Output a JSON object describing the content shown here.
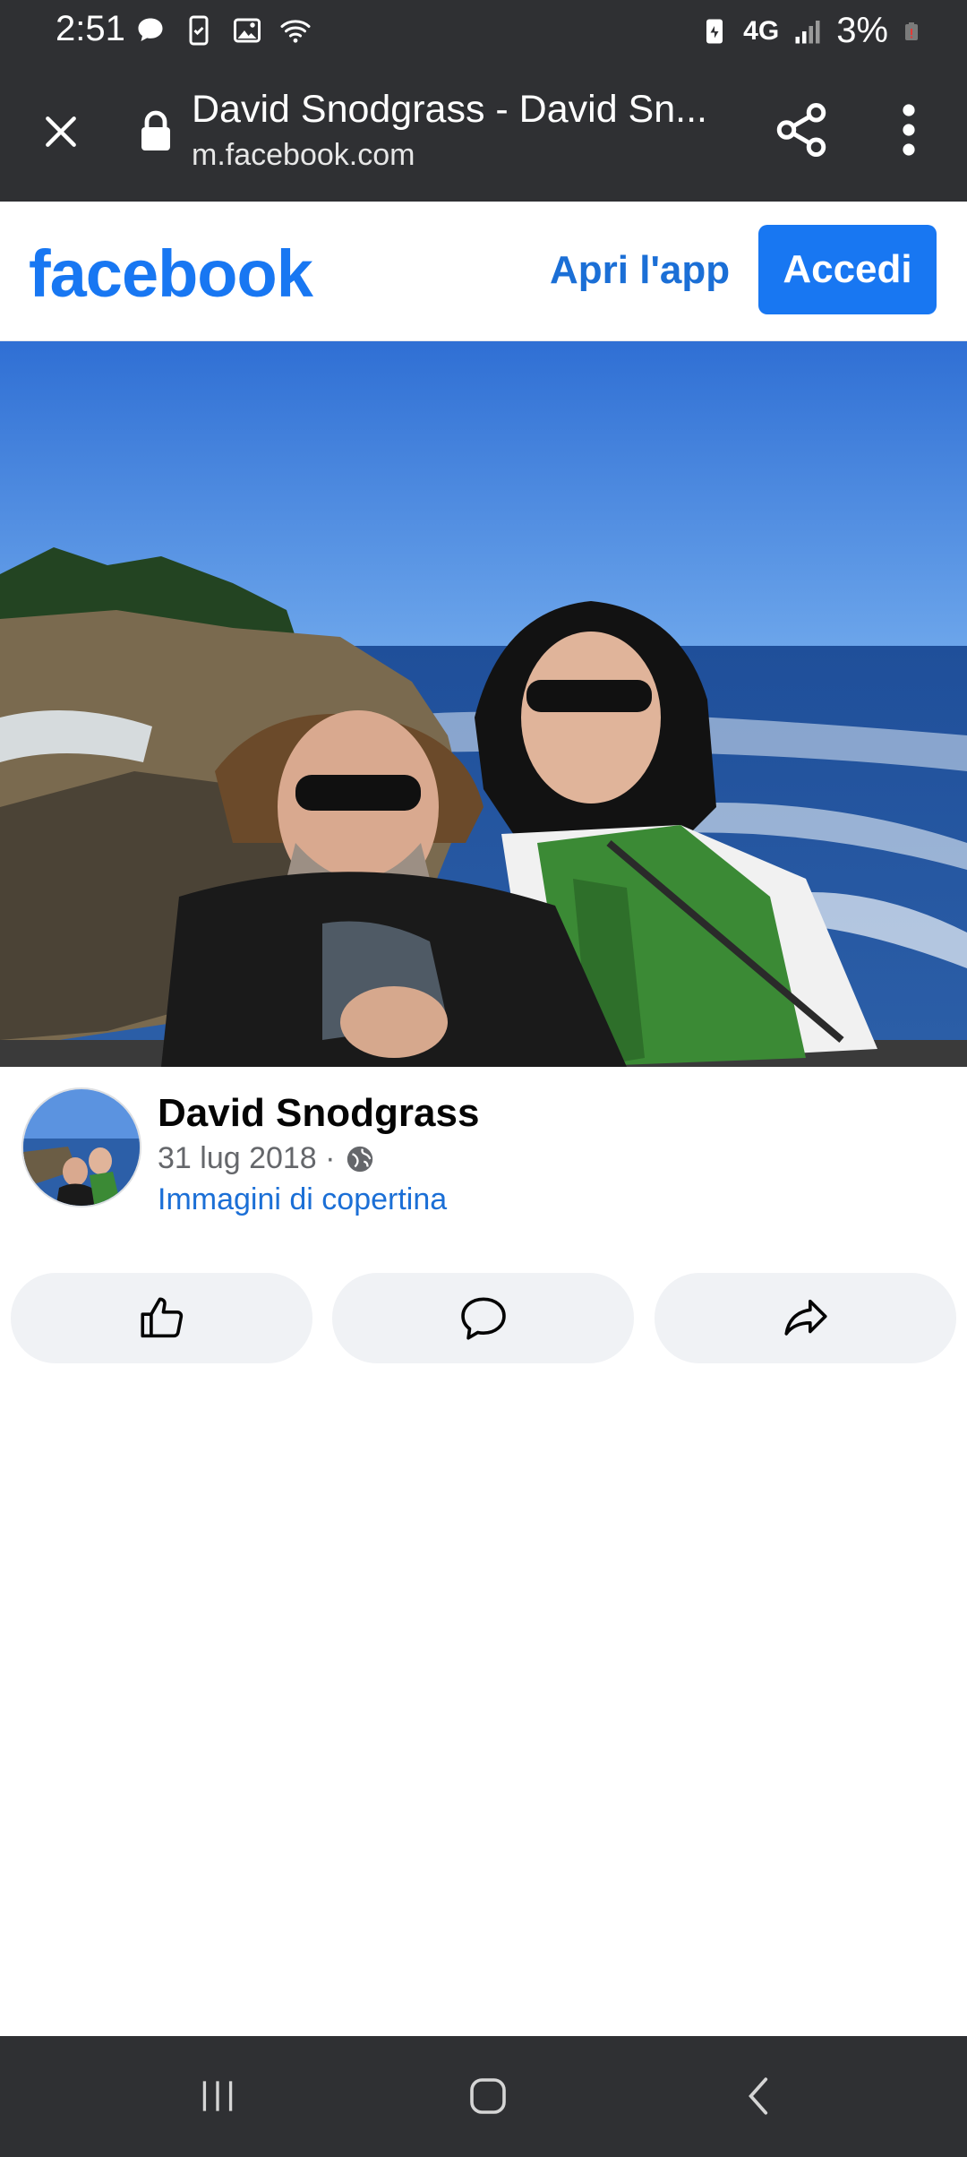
{
  "status_bar": {
    "time": "2:51",
    "network": "4G",
    "battery": "3%"
  },
  "browser": {
    "title": "David Snodgrass - David Sn...",
    "url": "m.facebook.com"
  },
  "fb_header": {
    "logo": "facebook",
    "open_app": "Apri l'app",
    "login": "Accedi"
  },
  "post": {
    "author": "David Snodgrass",
    "date": "31 lug 2018 ·",
    "album": "Immagini di copertina"
  },
  "colors": {
    "brand": "#1877f2",
    "link": "#1b6fd6",
    "system_bar": "#2f3033",
    "button_bg": "#f0f2f5"
  }
}
